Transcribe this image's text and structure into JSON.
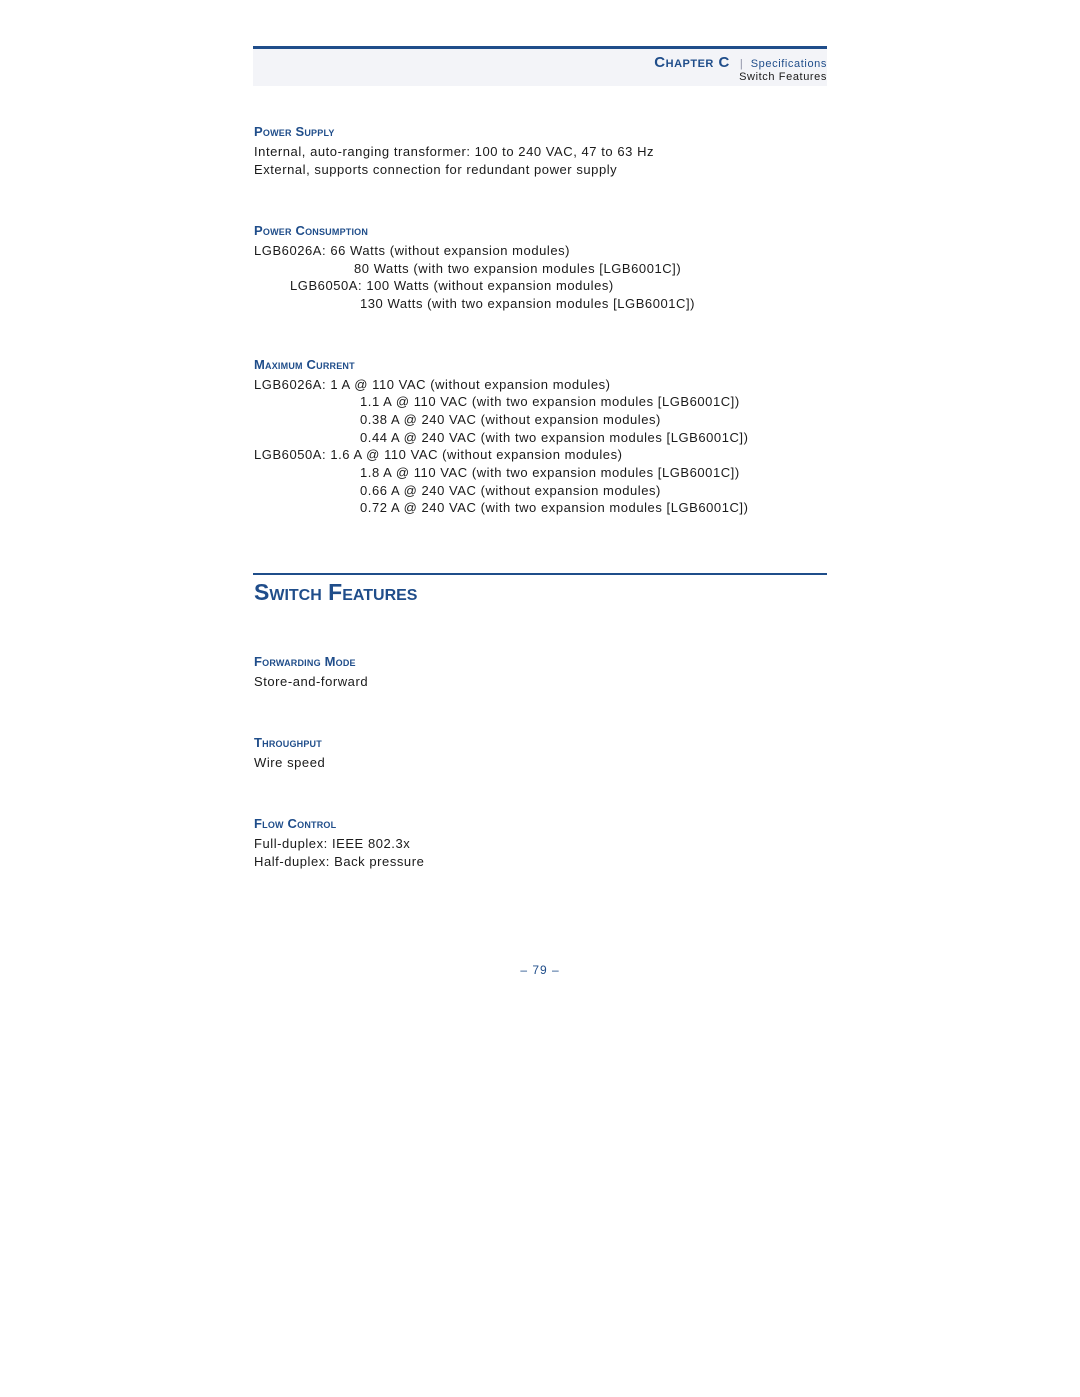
{
  "header": {
    "chapter": "Chapter C",
    "separator": "|",
    "section": "Specifications",
    "subsection": "Switch Features"
  },
  "power_supply": {
    "title": "Power Supply",
    "lines": [
      "Internal, auto-ranging transformer: 100 to 240 VAC, 47 to 63 Hz",
      "External, supports connection for redundant power supply"
    ]
  },
  "power_consumption": {
    "title": "Power Consumption",
    "lines": [
      "LGB6026A: 66 Watts (without expansion modules)",
      "80 Watts (with two expansion modules [LGB6001C])",
      "LGB6050A: 100 Watts (without expansion modules)",
      "130 Watts (with two expansion modules [LGB6001C])"
    ]
  },
  "maximum_current": {
    "title": "Maximum Current",
    "lines": [
      "LGB6026A: 1 A @ 110 VAC (without expansion modules)",
      "1.1 A @ 110 VAC (with two expansion modules [LGB6001C])",
      "0.38 A @ 240 VAC (without expansion modules)",
      "0.44 A @ 240 VAC (with two expansion modules [LGB6001C])",
      "LGB6050A: 1.6 A @ 110 VAC (without expansion modules)",
      "1.8 A @ 110 VAC (with two expansion modules [LGB6001C])",
      "0.66 A @ 240 VAC (without expansion modules)",
      "0.72 A @ 240 VAC (with two expansion modules [LGB6001C])"
    ]
  },
  "switch_features": {
    "title": "Switch Features",
    "forwarding_mode": {
      "title": "Forwarding Mode",
      "value": "Store-and-forward"
    },
    "throughput": {
      "title": "Throughput",
      "value": "Wire speed"
    },
    "flow_control": {
      "title": "Flow Control",
      "lines": [
        "Full-duplex: IEEE 802.3x",
        "Half-duplex: Back pressure"
      ]
    }
  },
  "page_number": "–  79  –"
}
